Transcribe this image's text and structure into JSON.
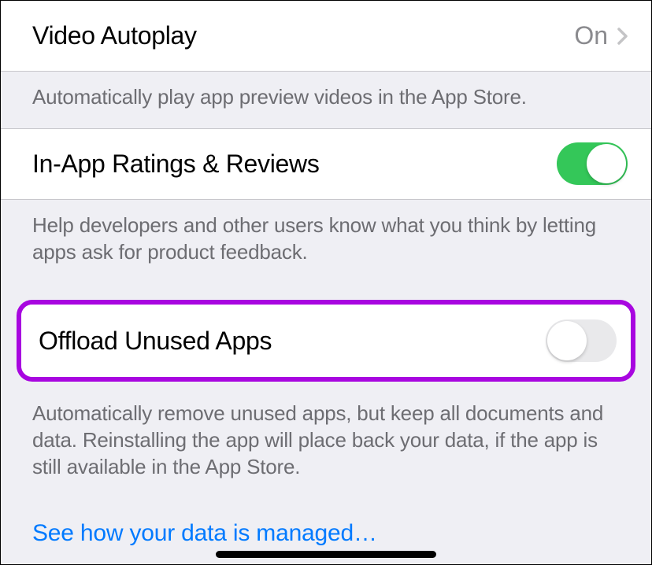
{
  "rows": {
    "video_autoplay": {
      "label": "Video Autoplay",
      "value": "On"
    },
    "video_autoplay_footer": "Automatically play app preview videos in the App Store.",
    "in_app_ratings": {
      "label": "In-App Ratings & Reviews"
    },
    "in_app_ratings_footer": "Help developers and other users know what you think by letting apps ask for product feedback.",
    "offload_unused": {
      "label": "Offload Unused Apps"
    },
    "offload_unused_footer": "Automatically remove unused apps, but keep all documents and data. Reinstalling the app will place back your data, if the app is still available in the App Store.",
    "data_managed_link": "See how your data is managed…"
  }
}
